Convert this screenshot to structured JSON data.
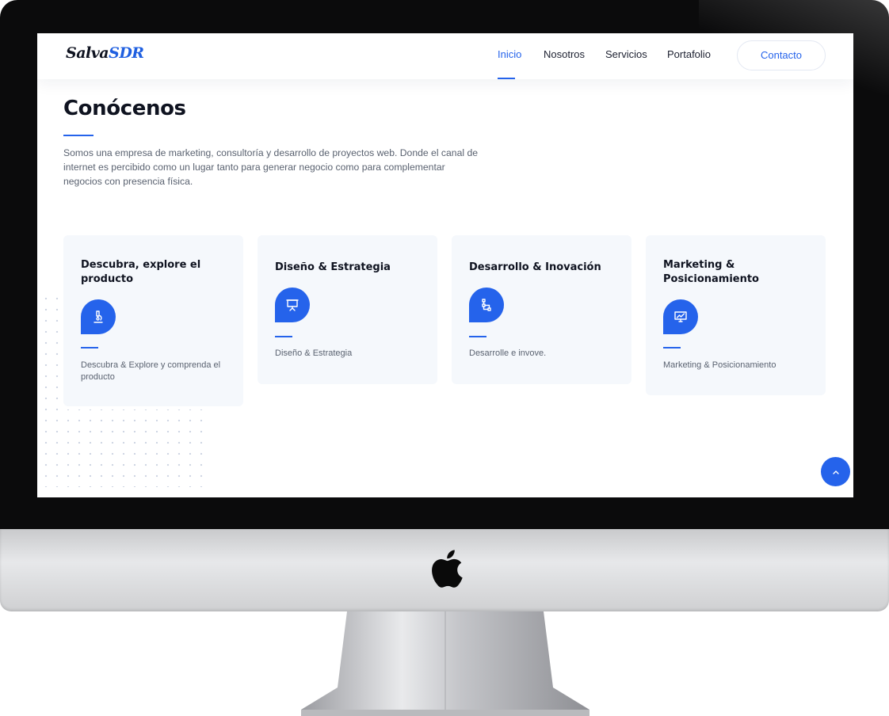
{
  "brand": {
    "logo_part1": "Salva",
    "logo_part2": "SDR"
  },
  "nav": {
    "items": [
      {
        "label": "Inicio",
        "active": true
      },
      {
        "label": "Nosotros"
      },
      {
        "label": "Servicios"
      },
      {
        "label": "Portafolio"
      }
    ],
    "contact_label": "Contacto"
  },
  "about": {
    "title": "Conócenos",
    "text": "Somos una empresa de marketing, consultoría y desarrollo de proyectos web. Donde el canal de internet es percibido como un lugar tanto para generar negocio como para complementar negocios con presencia física."
  },
  "cards": [
    {
      "title": "Descubra, explore el producto",
      "icon": "microscope-icon",
      "text": "Descubra & Explore y comprenda el producto"
    },
    {
      "title": "Diseño & Estrategia",
      "icon": "presentation-board-icon",
      "text": "Diseño & Estrategia"
    },
    {
      "title": "Desarrollo & Inovación",
      "icon": "flowchart-icon",
      "text": "Desarrolle e invove."
    },
    {
      "title": "Marketing & Posicionamiento",
      "icon": "monitor-chart-icon",
      "text": "Marketing & Posicionamiento"
    }
  ],
  "colors": {
    "accent": "#2563eb",
    "card_bg": "#f5f8fc",
    "heading": "#0f1320",
    "body_text": "#5a6270"
  }
}
